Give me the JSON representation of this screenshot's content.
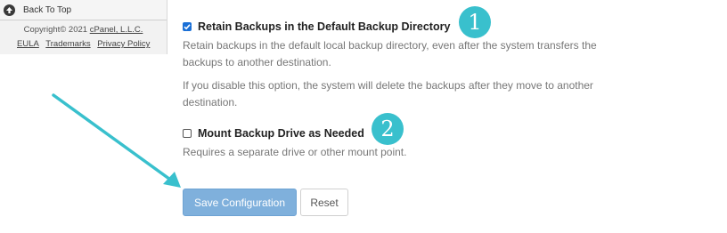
{
  "sidebar": {
    "back_to_top_label": "Back To Top",
    "back_to_top_icon": "arrow-up-circle-icon",
    "copyright_prefix": "Copyright© 2021",
    "copyright_link": "cPanel, L.L.C.",
    "links": [
      "EULA",
      "Trademarks",
      "Privacy Policy"
    ]
  },
  "options": {
    "retain": {
      "checked": true,
      "label": "Retain Backups in the Default Backup Directory",
      "description": "Retain backups in the default local backup directory, even after the system transfers the backups to another destination.",
      "note": "If you disable this option, the system will delete the backups after they move to another destination.",
      "badge": "1"
    },
    "mount": {
      "checked": false,
      "label": "Mount Backup Drive as Needed",
      "description": "Requires a separate drive or other mount point.",
      "badge": "2"
    }
  },
  "actions": {
    "save_label": "Save Configuration",
    "reset_label": "Reset"
  },
  "colors": {
    "badge": "#39c0cd",
    "arrow": "#39c0cd",
    "save_button": "#7fb0dc",
    "checkbox_checked": "#1a6fd6"
  }
}
